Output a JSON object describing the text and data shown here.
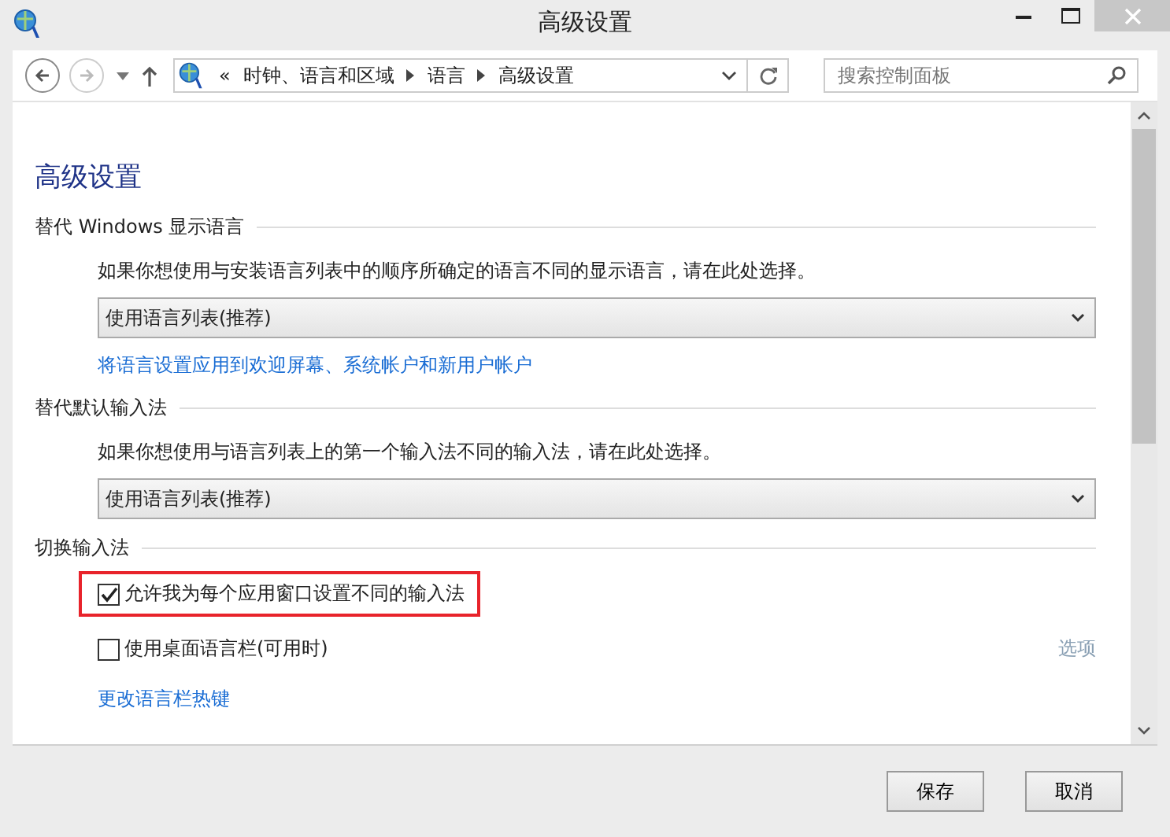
{
  "window": {
    "title": "高级设置"
  },
  "address_bar": {
    "overflow": "«",
    "path": [
      "时钟、语言和区域",
      "语言",
      "高级设置"
    ]
  },
  "search": {
    "placeholder": "搜索控制面板"
  },
  "heading": "高级设置",
  "sections": [
    {
      "title": "替代 Windows 显示语言",
      "items": [
        {
          "kind": "text",
          "text": "如果你想使用与安装语言列表中的顺序所确定的语言不同的显示语言，请在此处选择。"
        },
        {
          "kind": "dropdown",
          "value": "使用语言列表(推荐)"
        },
        {
          "kind": "link",
          "text": "将语言设置应用到欢迎屏幕、系统帐户和新用户帐户"
        }
      ]
    },
    {
      "title": "替代默认输入法",
      "items": [
        {
          "kind": "text",
          "text": "如果你想使用与语言列表上的第一个输入法不同的输入法，请在此处选择。"
        },
        {
          "kind": "dropdown",
          "value": "使用语言列表(推荐)"
        }
      ]
    },
    {
      "title": "切换输入法",
      "items": [
        {
          "kind": "checkbox",
          "label": "允许我为每个应用窗口设置不同的输入法",
          "checked": true,
          "highlighted": true
        },
        {
          "kind": "checkbox",
          "label": "使用桌面语言栏(可用时)",
          "checked": false,
          "highlighted": false,
          "option": {
            "text": "选项",
            "disabled": true
          }
        },
        {
          "kind": "link",
          "text": "更改语言栏热键"
        }
      ]
    }
  ],
  "buttons": [
    "保存",
    "取消"
  ]
}
